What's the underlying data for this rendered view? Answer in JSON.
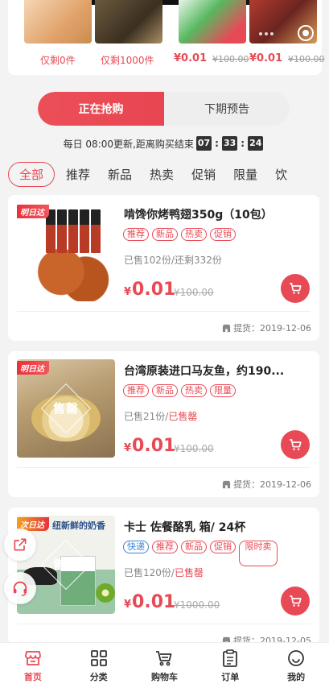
{
  "top_strip": {
    "left": [
      {
        "label": "仅剩0件"
      },
      {
        "label": "仅剩1000件"
      }
    ],
    "right": [
      {
        "price": "¥0.01",
        "old_price": "¥100.00"
      },
      {
        "price": "¥0.01",
        "old_price": "¥100.00"
      }
    ]
  },
  "switch": {
    "active_label": "正在抢购",
    "inactive_label": "下期预告"
  },
  "countdown": {
    "prefix": "每日 08:00更新,距离购买结束",
    "hours": "07",
    "minutes": "33",
    "seconds": "24",
    "sep": ":"
  },
  "categories": [
    "全部",
    "推荐",
    "新品",
    "热卖",
    "促销",
    "限量",
    "饮"
  ],
  "products": [
    {
      "ribbon": "明日达",
      "title": "啃馋你烤鸭翅350g（10包）",
      "tags": [
        "推荐",
        "新品",
        "热卖",
        "促销"
      ],
      "sold": "已售102份/",
      "stock": "还剩332份",
      "yen": "¥",
      "price": "0.01",
      "old_price": "¥100.00",
      "pickup": "提货：2019-12-06"
    },
    {
      "ribbon": "明日达",
      "title": "台湾原装进口马友鱼，约190...",
      "tags": [
        "推荐",
        "新品",
        "热卖",
        "限量"
      ],
      "sold": "已售21份/",
      "stock": "已售罄",
      "soldout": "售罄",
      "yen": "¥",
      "price": "0.01",
      "old_price": "¥100.00",
      "pickup": "提货：2019-12-06"
    },
    {
      "ribbon": "次日达",
      "image_title": "纽新鲜的奶香",
      "title": "卡士 佐餐酪乳 箱/ 24杯",
      "tags": [
        "快递",
        "推荐",
        "新品",
        "促销",
        "限时卖"
      ],
      "sold": "已售120份/",
      "stock": "已售罄",
      "soldout": "售罄",
      "yen": "¥",
      "price": "0.01",
      "old_price": "¥1000.00",
      "pickup": "提货：2019-12-05"
    }
  ],
  "tabbar": [
    {
      "label": "首页",
      "icon": "shop-icon"
    },
    {
      "label": "分类",
      "icon": "grid-icon"
    },
    {
      "label": "购物车",
      "icon": "cart-icon"
    },
    {
      "label": "订单",
      "icon": "clipboard-icon"
    },
    {
      "label": "我的",
      "icon": "smile-icon"
    }
  ],
  "colors": {
    "accent": "#e84a55",
    "blue": "#3b82d6",
    "bg": "#f3f3f3"
  }
}
